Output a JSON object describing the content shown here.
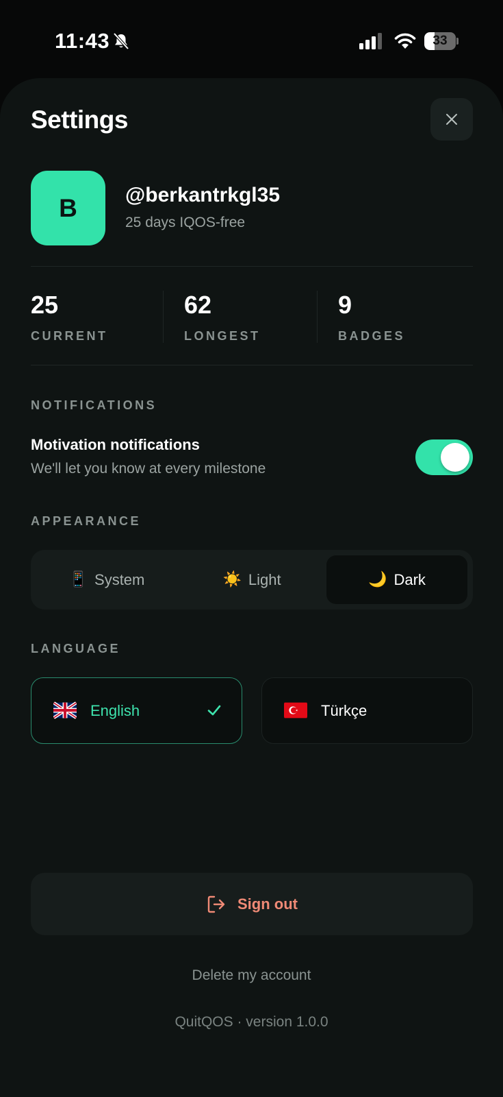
{
  "status_bar": {
    "time": "11:43",
    "battery": "33",
    "battery_level_percent": 33,
    "icons": [
      "bell-slash-icon",
      "cellular-signal-icon",
      "wifi-icon",
      "battery-icon"
    ]
  },
  "header": {
    "title": "Settings",
    "close_icon": "close-icon"
  },
  "profile": {
    "avatar_initial": "B",
    "avatar_color": "#33e2aa",
    "username": "@berkantrkgl35",
    "subtitle": "25 days IQOS-free"
  },
  "stats": [
    {
      "value": "25",
      "label": "CURRENT"
    },
    {
      "value": "62",
      "label": "LONGEST"
    },
    {
      "value": "9",
      "label": "BADGES"
    }
  ],
  "notifications": {
    "section_label": "NOTIFICATIONS",
    "title": "Motivation notifications",
    "description": "We'll let you know at every milestone",
    "enabled": true
  },
  "appearance": {
    "section_label": "APPEARANCE",
    "options": [
      {
        "emoji": "📱",
        "label": "System"
      },
      {
        "emoji": "☀️",
        "label": "Light"
      },
      {
        "emoji": "🌙",
        "label": "Dark"
      }
    ],
    "selected": "Dark"
  },
  "language": {
    "section_label": "LANGUAGE",
    "options": [
      {
        "flag": "uk-flag-icon",
        "label": "English"
      },
      {
        "flag": "turkey-flag-icon",
        "label": "Türkçe"
      }
    ],
    "selected": "English"
  },
  "actions": {
    "sign_out_label": "Sign out",
    "delete_account_label": "Delete my account"
  },
  "footer": {
    "version_text": "QuitQOS · version 1.0.0"
  },
  "colors": {
    "accent": "#33e2aa",
    "danger": "#f08a76",
    "background": "#0f1413"
  }
}
